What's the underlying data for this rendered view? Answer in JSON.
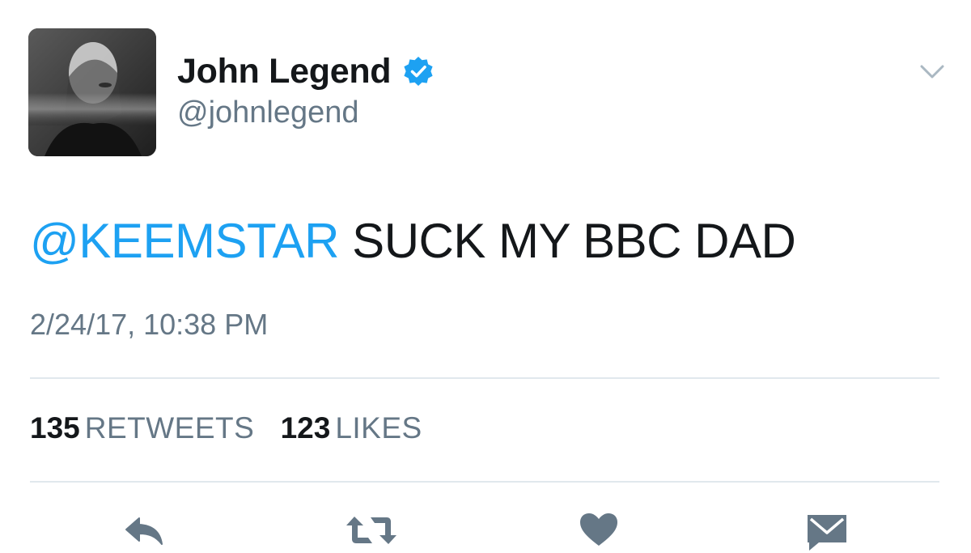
{
  "user": {
    "display_name": "John Legend",
    "handle": "@johnlegend",
    "verified": true
  },
  "tweet": {
    "mention": "@KEEMSTAR",
    "text": " SUCK MY BBC DAD",
    "timestamp": "2/24/17, 10:38 PM"
  },
  "stats": {
    "retweets_count": "135",
    "retweets_label": "RETWEETS",
    "likes_count": "123",
    "likes_label": "LIKES"
  },
  "actions": [
    "reply-icon",
    "retweet-icon",
    "like-icon",
    "direct-message-icon"
  ],
  "colors": {
    "link": "#1da1f2",
    "secondary_text": "#657786",
    "primary_text": "#14171a",
    "icon": "#657786",
    "divider": "#e1e8ed",
    "verified_badge": "#1da1f2"
  }
}
